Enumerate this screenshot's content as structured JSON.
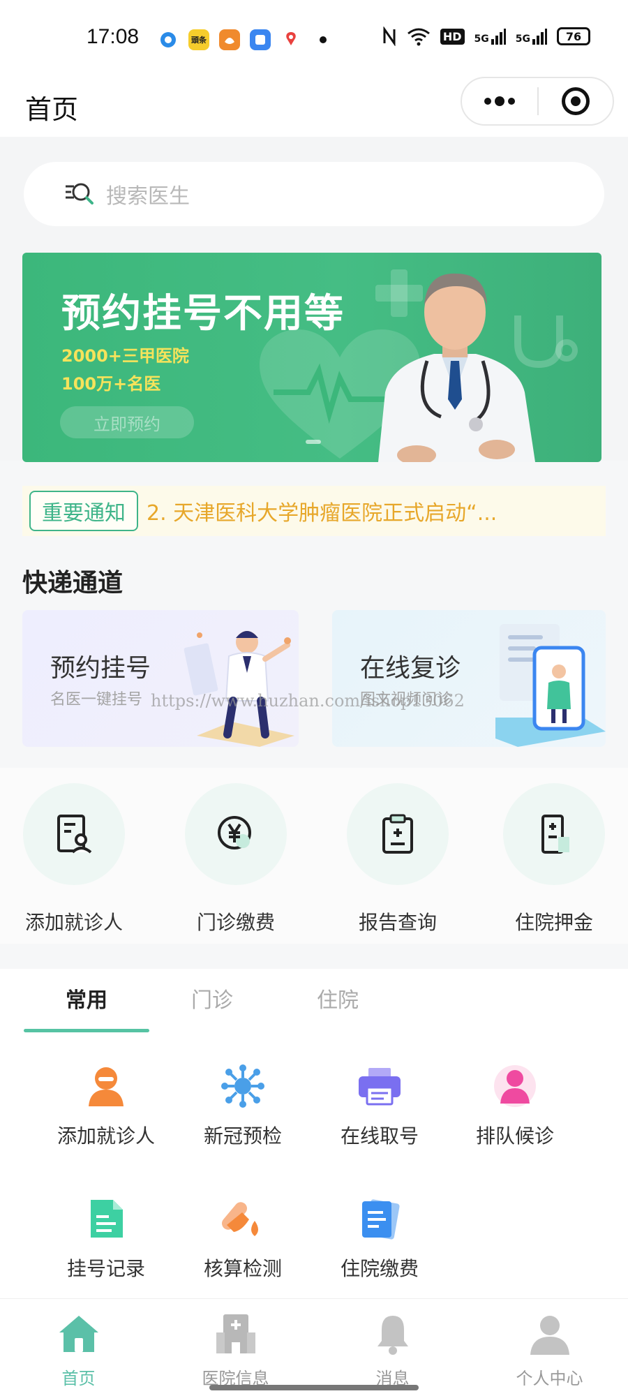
{
  "status_bar": {
    "time": "17:08",
    "app_icons": [
      {
        "name": "browser-app-icon",
        "color": "#2a8be8"
      },
      {
        "name": "news-app-icon",
        "color": "#f6cd2c",
        "text": "頭条"
      },
      {
        "name": "uc-browser-app-icon",
        "color": "#f08a2d"
      },
      {
        "name": "files-app-icon",
        "color": "#3b86f0"
      },
      {
        "name": "map-app-icon",
        "color": "#e9413e"
      }
    ],
    "signal_1": "5G",
    "signal_2": "5G",
    "hd_label": "HD",
    "battery": "76"
  },
  "header": {
    "title": "首页"
  },
  "search": {
    "placeholder": "搜索医生"
  },
  "banner": {
    "title": "预约挂号不用等",
    "line1": "2000+三甲医院",
    "line2": "100万+名医",
    "button": "立即预约"
  },
  "notice": {
    "tag": "重要通知",
    "text": "2. 天津医科大学肿瘤医院正式启动“..."
  },
  "quick_channel": {
    "title": "快递通道",
    "cards": [
      {
        "title": "预约挂号",
        "subtitle": "名医一键挂号"
      },
      {
        "title": "在线复诊",
        "subtitle": "图文视频问诊"
      }
    ],
    "watermark": "https://www.huzhan.com/ishop13062"
  },
  "shortcuts": [
    {
      "label": "添加就诊人",
      "icon": "patient-card-icon"
    },
    {
      "label": "门诊缴费",
      "icon": "yuan-coin-icon"
    },
    {
      "label": "报告查询",
      "icon": "clipboard-report-icon"
    },
    {
      "label": "住院押金",
      "icon": "hospital-deposit-icon"
    }
  ],
  "service_tabs": [
    "常用",
    "门诊",
    "住院"
  ],
  "services": [
    {
      "label": "添加就诊人",
      "icon": "person-orange-icon",
      "color": "#f5893a"
    },
    {
      "label": "新冠预检",
      "icon": "virus-icon",
      "color": "#4a9fe8"
    },
    {
      "label": "在线取号",
      "icon": "printer-icon",
      "color": "#7a6ff0"
    },
    {
      "label": "排队候诊",
      "icon": "person-pink-icon",
      "color": "#ef4aa0"
    },
    {
      "label": "挂号记录",
      "icon": "document-green-icon",
      "color": "#3dd0a2"
    },
    {
      "label": "核算检测",
      "icon": "test-tube-icon",
      "color": "#f5893a"
    },
    {
      "label": "住院缴费",
      "icon": "document-blue-icon",
      "color": "#3b8ff0"
    }
  ],
  "tabbar": [
    {
      "label": "首页",
      "icon": "home-icon"
    },
    {
      "label": "医院信息",
      "icon": "hospital-icon"
    },
    {
      "label": "消息",
      "icon": "bell-icon"
    },
    {
      "label": "个人中心",
      "icon": "user-icon"
    }
  ],
  "colors": {
    "primary": "#3eb489",
    "banner_green": "#43bb81",
    "notice_text": "#e7a72a",
    "tab_active": "#5bc0a8"
  }
}
